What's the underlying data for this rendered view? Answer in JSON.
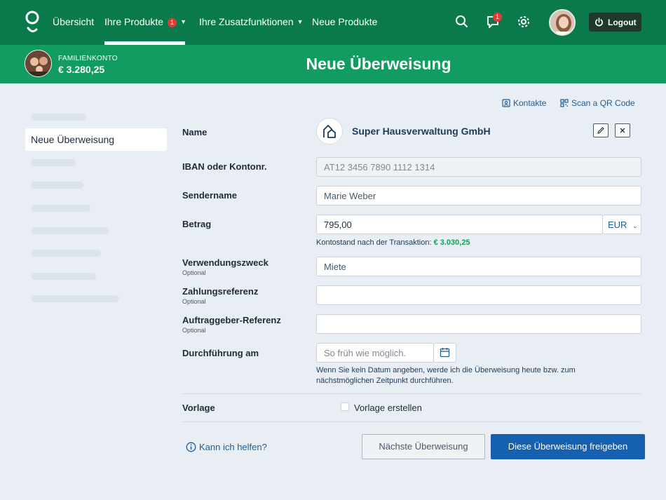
{
  "nav": {
    "items": [
      {
        "label": "Übersicht"
      },
      {
        "label": "Ihre Produkte",
        "badge": "1"
      },
      {
        "label": "Ihre Zusatzfunktionen"
      },
      {
        "label": "Neue Produkte"
      }
    ],
    "chat_badge": "1",
    "logout_label": "Logout",
    "icons": [
      "logo-icon",
      "search-icon",
      "chat-icon",
      "gear-icon",
      "power-icon"
    ],
    "accent_color": "#0a7a4c"
  },
  "account": {
    "label": "FAMILIENKONTO",
    "balance": "€ 3.280,25"
  },
  "page": {
    "title": "Neue Überweisung"
  },
  "sidebar": {
    "active_label": "Neue Überweisung"
  },
  "links": {
    "contacts": "Kontakte",
    "scan_qr": "Scan a QR Code"
  },
  "form": {
    "name_label": "Name",
    "payee_name": "Super Hausverwaltung GmbH",
    "iban_label": "IBAN oder Kontonr.",
    "iban_value": "AT12 3456 7890 1112 1314",
    "sender_label": "Sendername",
    "sender_value": "Marie Weber",
    "amount_label": "Betrag",
    "amount_value": "795,00",
    "currency": "EUR",
    "balance_hint": "Kontostand nach der Transaktion:",
    "balance_after": "€ 3.030,25",
    "purpose_label": "Verwendungszweck",
    "purpose_optional": "Optional",
    "purpose_value": "Miete",
    "payref_label": "Zahlungsreferenz",
    "payref_optional": "Optional",
    "payref_value": "",
    "clientref_label": "Auftraggeber-Referenz",
    "clientref_optional": "Optional",
    "clientref_value": "",
    "date_label": "Durchführung am",
    "date_placeholder": "So früh wie möglich.",
    "date_hint_line1": "Wenn Sie kein Datum angeben, werde ich die Überweisung heute bzw. zum",
    "date_hint_line2": "nächstmöglichen Zeitpunkt durchführen.",
    "template_label": "Vorlage",
    "template_checkbox": "Vorlage erstellen"
  },
  "footer": {
    "help": "Kann ich helfen?",
    "next_button": "Nächste Überweisung",
    "submit_button": "Diese Überweisung freigeben"
  }
}
